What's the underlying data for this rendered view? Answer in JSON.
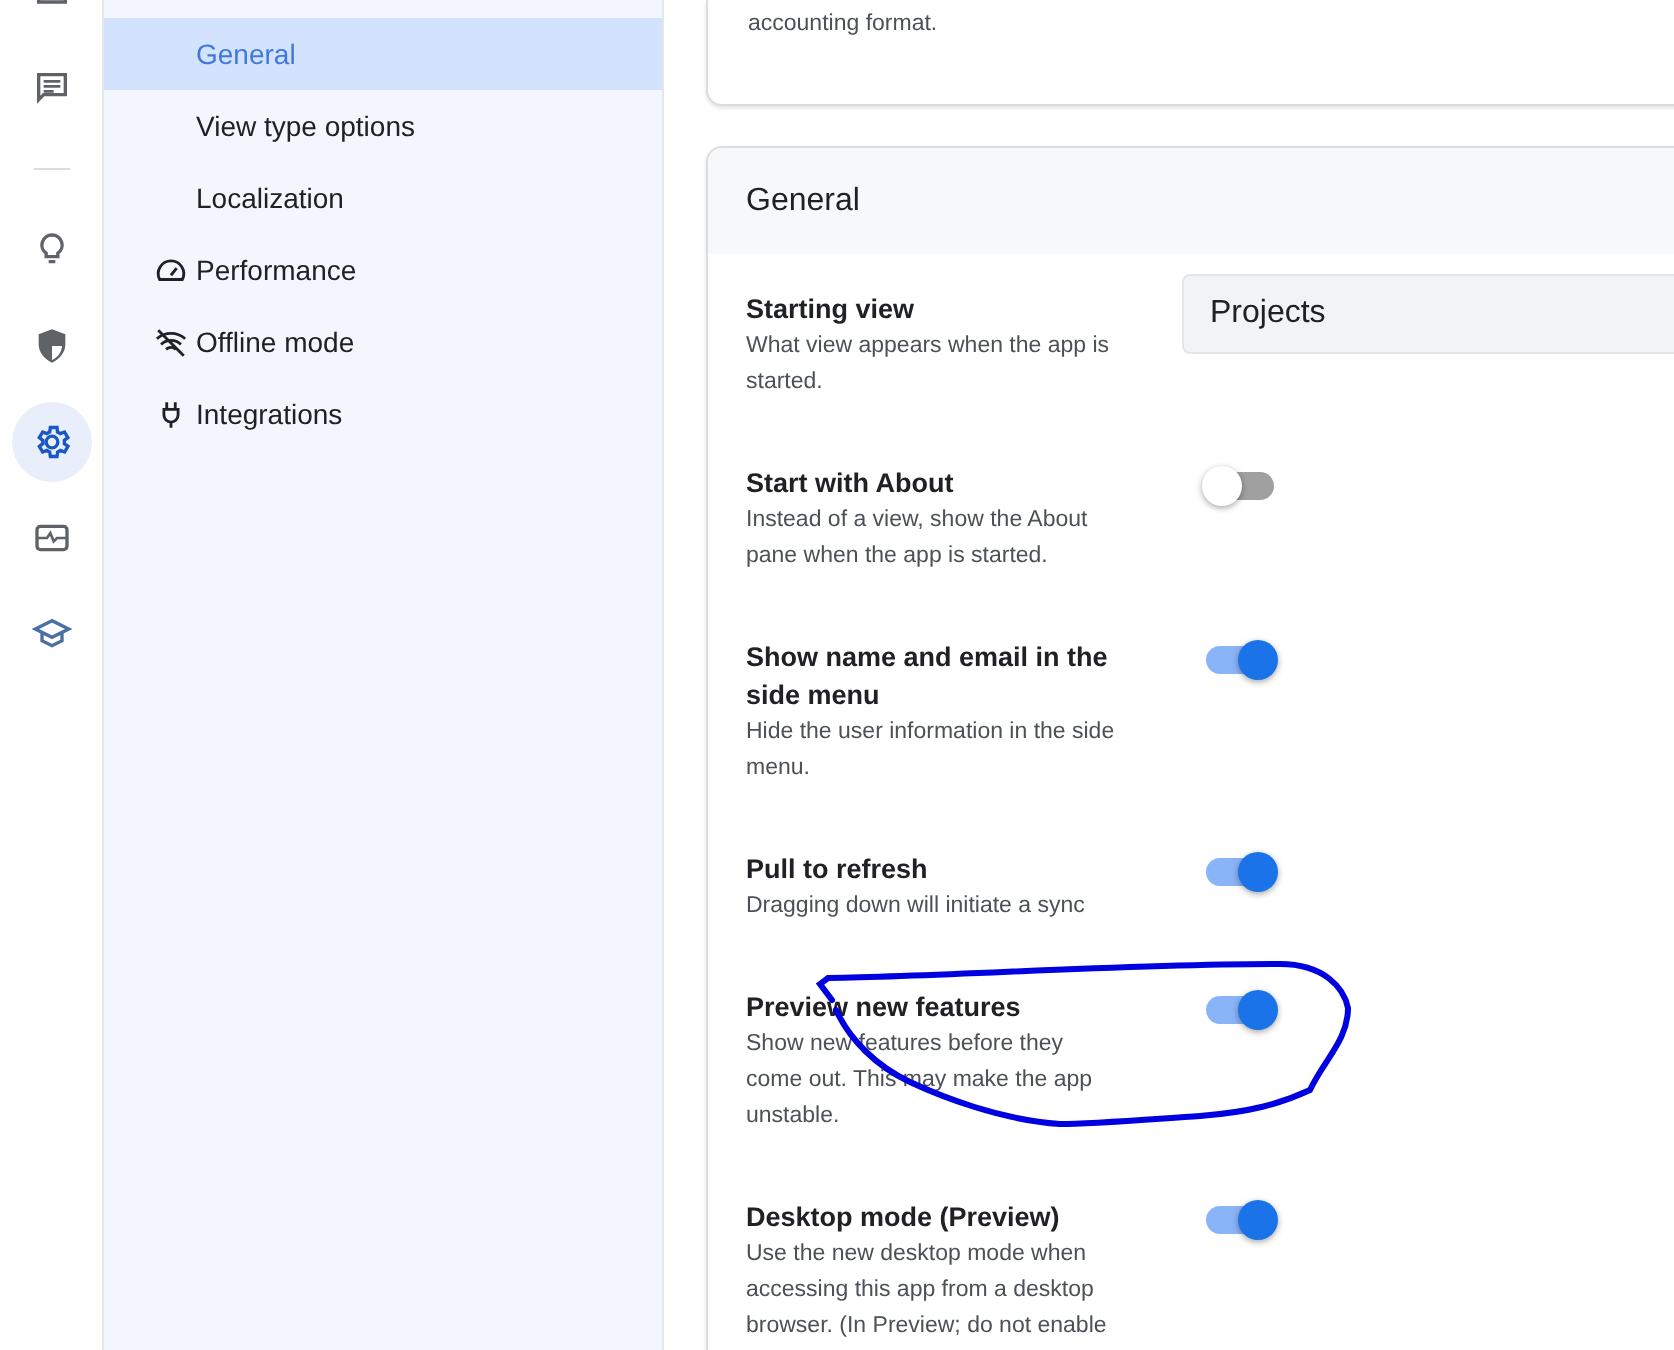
{
  "rail": {
    "top": [
      {
        "selected": false
      },
      {
        "selected": false
      }
    ],
    "bottom": [
      {
        "selected": false
      },
      {
        "selected": false
      },
      {
        "selected": true
      },
      {
        "selected": false
      },
      {
        "selected": false
      }
    ]
  },
  "sidebar": {
    "items": [
      {
        "kind": "subpage",
        "label": "General",
        "selected": true
      },
      {
        "kind": "subpage",
        "label": "View type options",
        "selected": false
      },
      {
        "kind": "subpage",
        "label": "Localization",
        "selected": false
      },
      {
        "kind": "section",
        "label": "Performance",
        "selected": false
      },
      {
        "kind": "section",
        "label": "Offline mode",
        "selected": false
      },
      {
        "kind": "section",
        "label": "Integrations",
        "selected": false
      }
    ]
  },
  "cards": [
    {
      "kind": "partial",
      "text": "accounting format."
    },
    {
      "kind": "full",
      "title": "General",
      "rows": [
        {
          "kind": "select",
          "title": "Starting view",
          "description": "What view appears when the app is started.",
          "value": "Projects"
        },
        {
          "kind": "toggle",
          "title": "Start with About",
          "description": "Instead of a view, show the About pane when the app is started.",
          "on": false
        },
        {
          "kind": "toggle",
          "title": "Show name and email in the side menu",
          "description": "Hide the user information in the side menu.",
          "on": true
        },
        {
          "kind": "toggle",
          "title": "Pull to refresh",
          "description": "Dragging down will initiate a sync",
          "on": true
        },
        {
          "kind": "toggle",
          "title": "Preview new features",
          "description": "Show new features before they come out. This may make the app unstable.",
          "on": true
        },
        {
          "kind": "toggle",
          "title": "Desktop mode (Preview)",
          "description": "Use the new desktop mode when accessing this app from a desktop browser. (In Preview; do not enable",
          "on": true
        }
      ]
    }
  ],
  "annotation": {
    "kind": "freehand-circle"
  }
}
